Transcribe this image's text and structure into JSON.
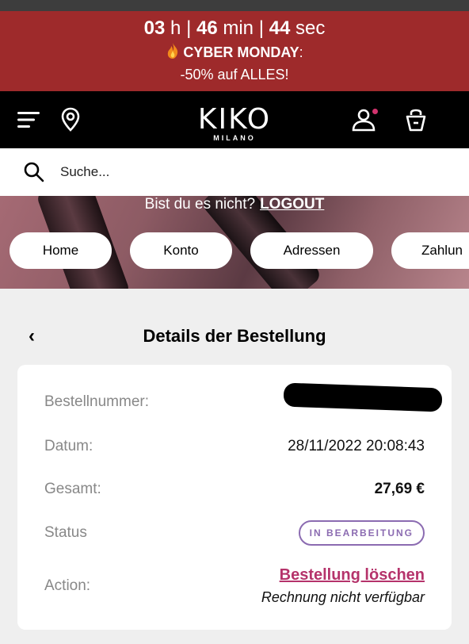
{
  "promo": {
    "hours": "03",
    "hours_unit": "h",
    "minutes": "46",
    "minutes_unit": "min",
    "seconds": "44",
    "seconds_unit": "sec",
    "separator": "|",
    "event": "CYBER MONDAY",
    "event_suffix": ":",
    "offer": "-50% auf ALLES!",
    "icon": "flame-icon",
    "color": "#9e2a2b"
  },
  "header": {
    "brand": "KIKO",
    "brand_sub": "MILANO",
    "icons": [
      "menu-icon",
      "location-pin-icon",
      "account-icon",
      "bag-icon"
    ],
    "notification_dot_color": "#d2336e"
  },
  "search": {
    "placeholder": "Suche..."
  },
  "account": {
    "not_you": "Bist du es nicht?",
    "logout": "LOGOUT",
    "nav": [
      {
        "label": "Home"
      },
      {
        "label": "Konto"
      },
      {
        "label": "Adressen"
      },
      {
        "label": "Zahlun"
      }
    ]
  },
  "order": {
    "title": "Details der Bestellung",
    "number_label": "Bestellnummer:",
    "date_label": "Datum:",
    "date_value": "28/11/2022 20:08:43",
    "total_label": "Gesamt:",
    "total_value": "27,69 €",
    "status_label": "Status",
    "status_value": "IN BEARBEITUNG",
    "action_label": "Action:",
    "delete_link": "Bestellung löschen",
    "invoice_note": "Rechnung nicht verfügbar",
    "accent": "#b5336b",
    "status_color": "#8b6bb1"
  }
}
